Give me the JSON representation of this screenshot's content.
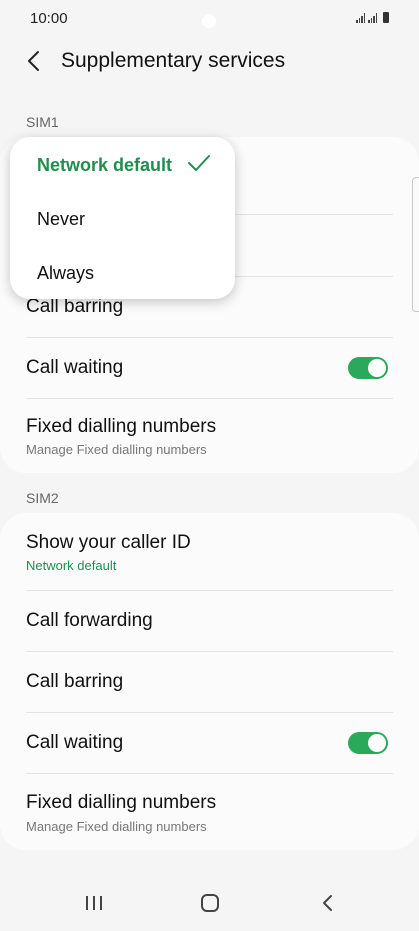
{
  "status_bar": {
    "time": "10:00"
  },
  "header": {
    "title": "Supplementary services"
  },
  "sim1": {
    "label": "SIM1",
    "call_barring": "Call barring",
    "call_waiting": "Call waiting",
    "call_waiting_on": true,
    "fixed_dialling": "Fixed dialling numbers",
    "fixed_dialling_sub": "Manage Fixed dialling numbers"
  },
  "dropdown": {
    "options": [
      "Network default",
      "Never",
      "Always"
    ],
    "selected": "Network default"
  },
  "sim2": {
    "label": "SIM2",
    "caller_id": "Show your caller ID",
    "caller_id_value": "Network default",
    "call_forwarding": "Call forwarding",
    "call_barring": "Call barring",
    "call_waiting": "Call waiting",
    "call_waiting_on": true,
    "fixed_dialling": "Fixed dialling numbers",
    "fixed_dialling_sub": "Manage Fixed dialling numbers"
  },
  "colors": {
    "accent": "#1f8f4f",
    "toggle": "#2aa95b",
    "background": "#f5f5f5"
  },
  "icons": [
    "back-arrow-icon",
    "checkmark-icon",
    "recent-apps-icon",
    "home-icon",
    "nav-back-icon"
  ]
}
